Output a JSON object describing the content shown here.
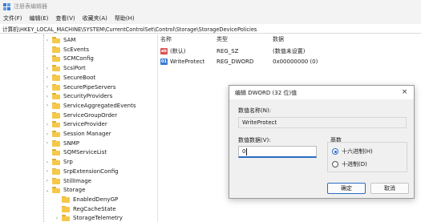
{
  "window": {
    "title": "注册表编辑器"
  },
  "menu": [
    "文件(F)",
    "编辑(E)",
    "查看(V)",
    "收藏夹(A)",
    "帮助(H)"
  ],
  "address": "计算机\\HKEY_LOCAL_MACHINE\\SYSTEM\\CurrentControlSet\\Control\\Storage\\StorageDevicePolicies",
  "tree": {
    "items": [
      {
        "label": "SAM",
        "depth": 0,
        "chevron": "›"
      },
      {
        "label": "ScEvents",
        "depth": 0,
        "chevron": ""
      },
      {
        "label": "SCMConfig",
        "depth": 0,
        "chevron": ""
      },
      {
        "label": "ScsiPort",
        "depth": 0,
        "chevron": "›"
      },
      {
        "label": "SecureBoot",
        "depth": 0,
        "chevron": "›"
      },
      {
        "label": "SecurePipeServers",
        "depth": 0,
        "chevron": "›"
      },
      {
        "label": "SecurityProviders",
        "depth": 0,
        "chevron": "›"
      },
      {
        "label": "ServiceAggregatedEvents",
        "depth": 0,
        "chevron": "›"
      },
      {
        "label": "ServiceGroupOrder",
        "depth": 0,
        "chevron": ""
      },
      {
        "label": "ServiceProvider",
        "depth": 0,
        "chevron": "›"
      },
      {
        "label": "Session Manager",
        "depth": 0,
        "chevron": "›"
      },
      {
        "label": "SNMP",
        "depth": 0,
        "chevron": "›"
      },
      {
        "label": "SQMServiceList",
        "depth": 0,
        "chevron": ""
      },
      {
        "label": "Srp",
        "depth": 0,
        "chevron": "›"
      },
      {
        "label": "SrpExtensionConfig",
        "depth": 0,
        "chevron": "›"
      },
      {
        "label": "StillImage",
        "depth": 0,
        "chevron": "›"
      },
      {
        "label": "Storage",
        "depth": 0,
        "chevron": "⌄"
      },
      {
        "label": "EnabledDenyGP",
        "depth": 1,
        "chevron": ""
      },
      {
        "label": "RegCacheState",
        "depth": 1,
        "chevron": ""
      },
      {
        "label": "StorageTelemetry",
        "depth": 1,
        "chevron": "›"
      }
    ]
  },
  "list": {
    "headers": {
      "name": "名称",
      "type": "类型",
      "data": "数据"
    },
    "rows": [
      {
        "icon": "ab",
        "name": "(默认)",
        "type": "REG_SZ",
        "data": "(数值未设置)"
      },
      {
        "icon": "01",
        "name": "WriteProtect",
        "type": "REG_DWORD",
        "data": "0x00000000 (0)"
      }
    ]
  },
  "dialog": {
    "title": "编辑 DWORD (32 位)值",
    "close": "×",
    "value_name_label": "数值名称(N):",
    "value_name": "WriteProtect",
    "value_data_label": "数值数据(V):",
    "value_data": "0",
    "base_label": "基数",
    "base_options": [
      {
        "label": "十六进制(H)",
        "selected": true
      },
      {
        "label": "十进制(D)",
        "selected": false
      }
    ],
    "ok": "确定",
    "cancel": "取消"
  },
  "colors": {
    "accent": "#2b6cc4",
    "folder": "#f5c84a"
  }
}
